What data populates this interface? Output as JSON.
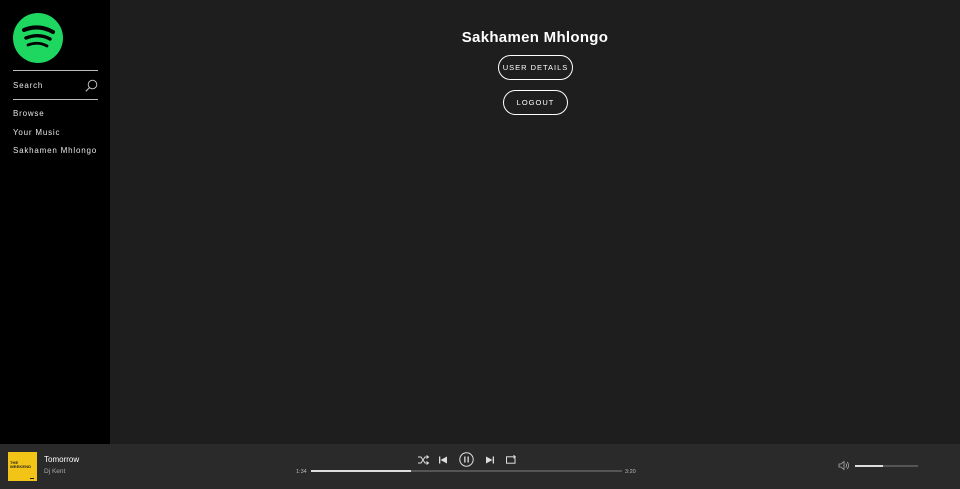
{
  "sidebar": {
    "search_label": "Search",
    "nav": [
      {
        "label": "Browse"
      },
      {
        "label": "Your Music"
      },
      {
        "label": "Sakhamen Mhlongo"
      }
    ]
  },
  "main": {
    "title": "Sakhamen Mhlongo",
    "user_details_label": "USER DETAILS",
    "logout_label": "LOGOUT"
  },
  "player": {
    "song": "Tomorrow",
    "artist": "Dj Kent",
    "cover_text": "THE WEEKEND",
    "current_time": "1:34",
    "total_time": "3:20",
    "progress": 0.32,
    "volume": 0.44
  },
  "colors": {
    "accent": "#1ed760",
    "main_bg": "#1e1e1e",
    "sidebar_bg": "#000000",
    "player_bg": "#2a2a2a"
  }
}
